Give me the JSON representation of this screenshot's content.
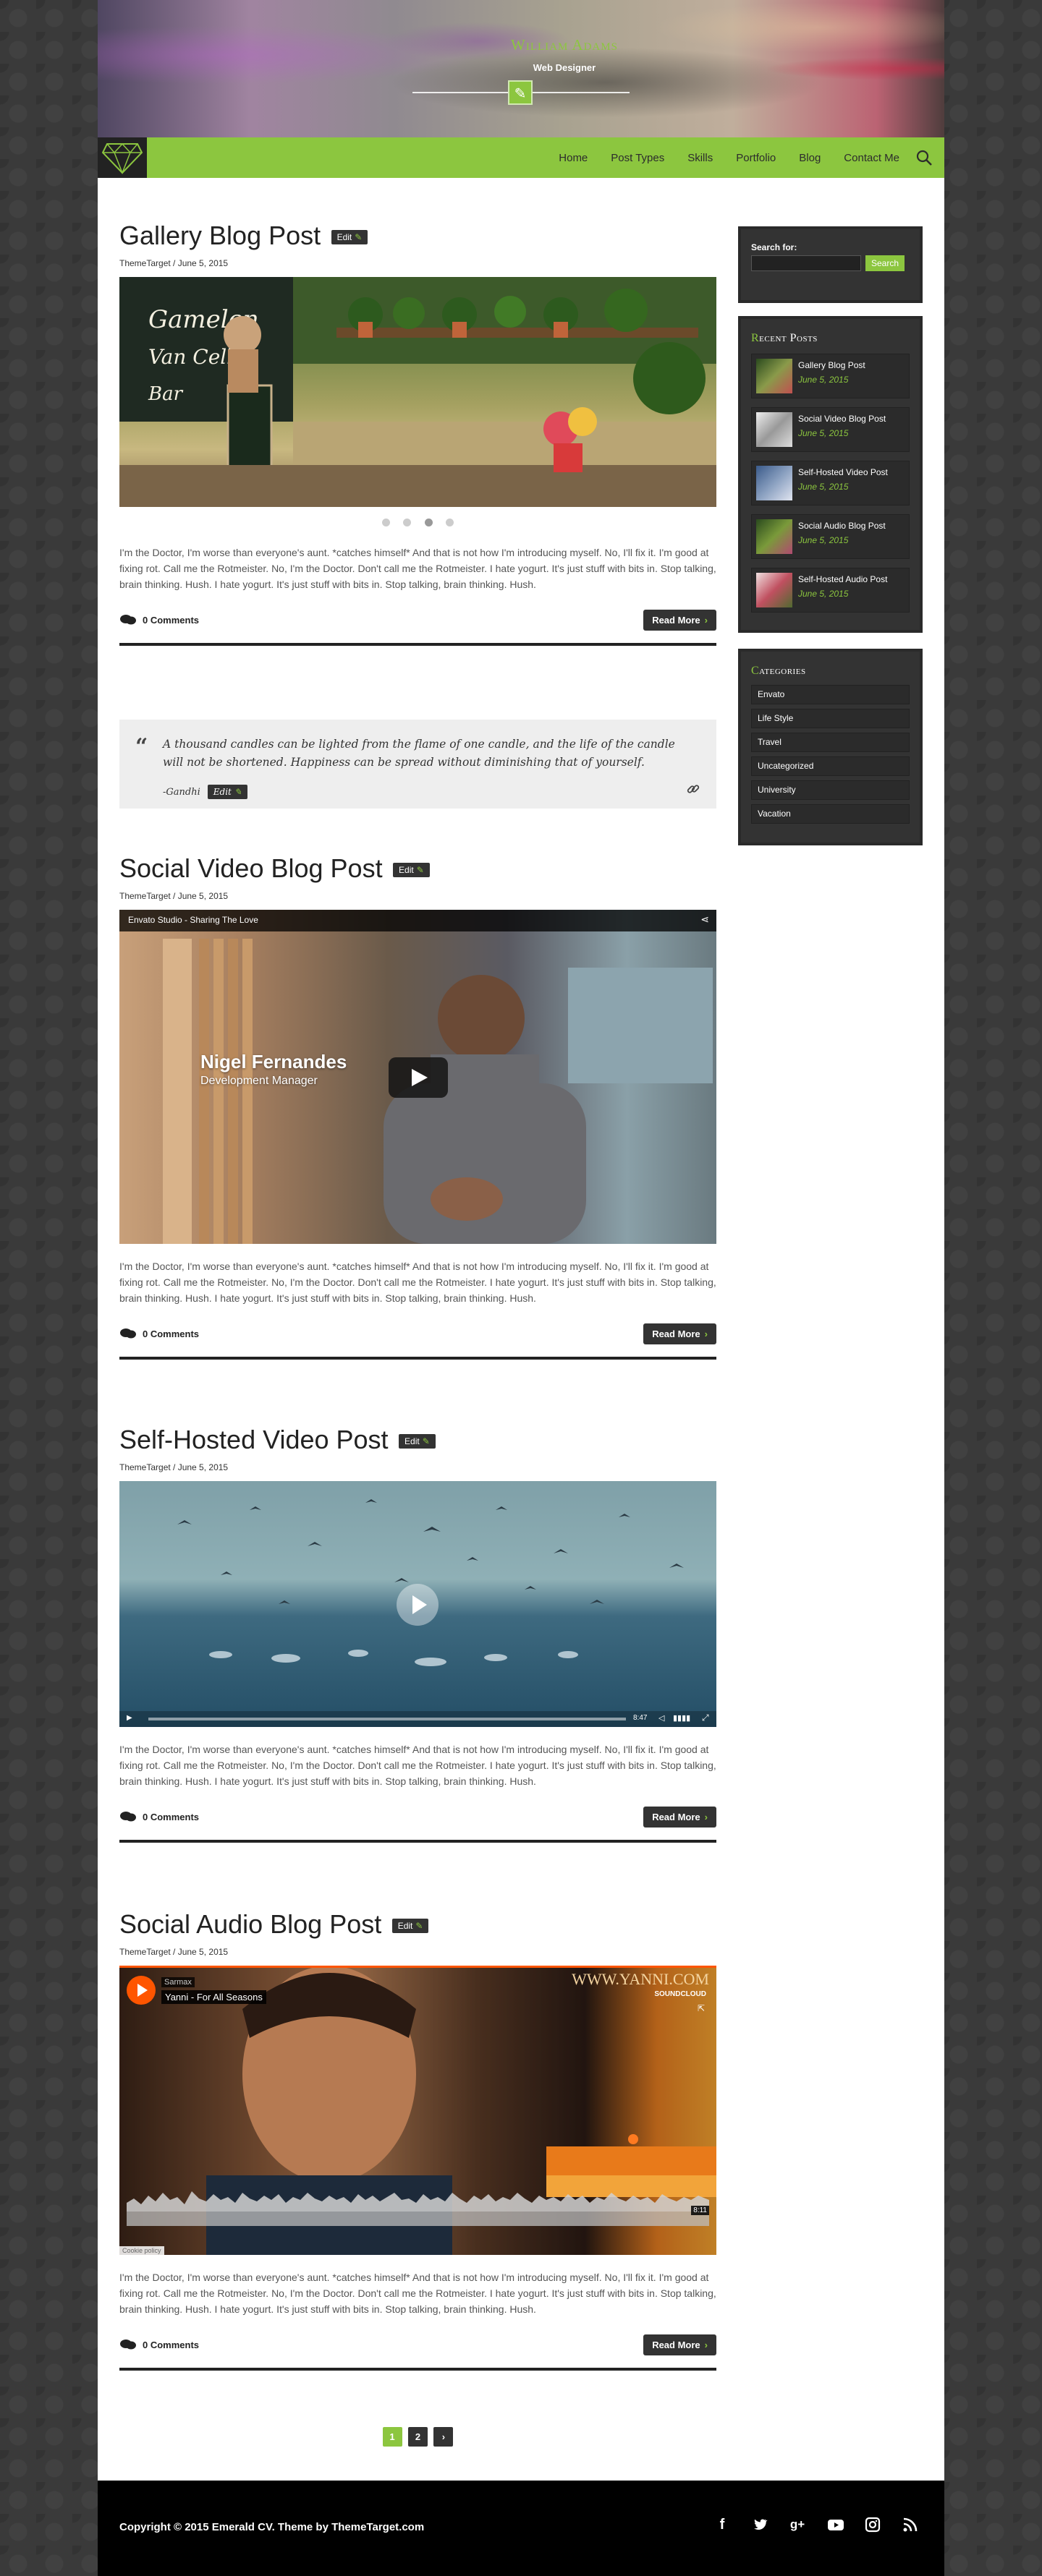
{
  "header": {
    "name": "William Adams",
    "role": "Web Designer"
  },
  "nav": {
    "items": [
      "Home",
      "Post Types",
      "Skills",
      "Portfolio",
      "Blog",
      "Contact Me"
    ]
  },
  "edit_label": "Edit",
  "read_more_label": "Read More",
  "excerpt": "I'm the Doctor, I'm worse than everyone's aunt. *catches himself* And that is not how I'm introducing myself. No, I'll fix it. I'm good at fixing rot. Call me the Rotmeister. No, I'm the Doctor. Don't call me the Rotmeister. I hate yogurt. It's just stuff with bits in. Stop talking, brain thinking. Hush. I hate yogurt. It's just stuff with bits in. Stop talking, brain thinking. Hush.",
  "posts": [
    {
      "title": "Gallery Blog Post",
      "meta": "ThemeTarget / June 5, 2015",
      "comments": "0 Comments"
    },
    {
      "title": "Social Video Blog Post",
      "meta": "ThemeTarget / June 5, 2015",
      "comments": "0 Comments"
    },
    {
      "title": "Self-Hosted Video Post",
      "meta": "ThemeTarget / June 5, 2015",
      "comments": "0 Comments"
    },
    {
      "title": "Social Audio Blog Post",
      "meta": "ThemeTarget / June 5, 2015",
      "comments": "0 Comments"
    }
  ],
  "gallery": {
    "slide_count": 4,
    "active_slide": 3
  },
  "quote": {
    "text": "A thousand candles can be lighted from the flame of one candle, and the life of the candle will not be shortened. Happiness can be spread without diminishing that of yourself.",
    "author": "-Gandhi"
  },
  "social_video": {
    "channel": "Envato Studio - Sharing The Love",
    "person_name": "Nigel Fernandes",
    "person_title": "Development Manager"
  },
  "self_hosted_video": {
    "time": "8:47"
  },
  "audio": {
    "artist": "Sarmax",
    "track": "Yanni - For All Seasons",
    "site": "WWW.YANNI.COM",
    "provider": "SOUNDCLOUD",
    "duration": "8:11",
    "cookie_policy": "Cookie policy"
  },
  "sidebar": {
    "search_label": "Search for:",
    "search_value": "",
    "search_button": "Search",
    "recent_title": "Recent Posts",
    "recent_posts": [
      {
        "title": "Gallery Blog Post",
        "date": "June 5, 2015"
      },
      {
        "title": "Social Video Blog Post",
        "date": "June 5, 2015"
      },
      {
        "title": "Self-Hosted Video Post",
        "date": "June 5, 2015"
      },
      {
        "title": "Social Audio Blog Post",
        "date": "June 5, 2015"
      },
      {
        "title": "Self-Hosted Audio Post",
        "date": "June 5, 2015"
      }
    ],
    "categories_title": "Categories",
    "categories": [
      "Envato",
      "Life Style",
      "Travel",
      "Uncategorized",
      "University",
      "Vacation"
    ]
  },
  "pagination": {
    "pages": [
      "1",
      "2"
    ],
    "current": "1",
    "next": "›"
  },
  "footer": {
    "copyright": "Copyright © 2015 Emerald CV. Theme by ThemeTarget.com",
    "socials": [
      "facebook-icon",
      "twitter-icon",
      "google-plus-icon",
      "youtube-icon",
      "instagram-icon",
      "rss-icon"
    ]
  },
  "colors": {
    "accent": "#8cc63f",
    "dark": "#333333",
    "footer": "#000000"
  }
}
